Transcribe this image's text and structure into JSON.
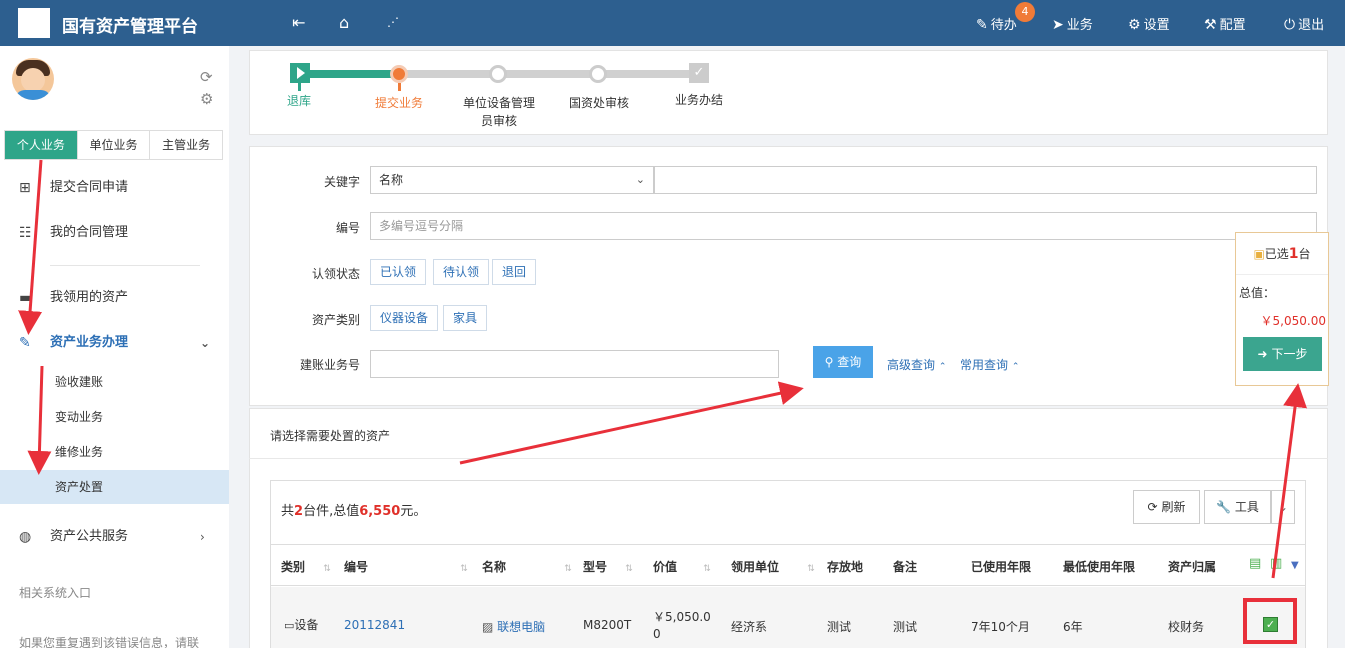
{
  "header": {
    "title": "国有资产管理平台",
    "badge_count": "4",
    "menu": [
      {
        "label": "待办",
        "icon": "edit-icon"
      },
      {
        "label": "业务",
        "icon": "paper-plane-icon"
      },
      {
        "label": "设置",
        "icon": "gear-icon"
      },
      {
        "label": "配置",
        "icon": "wrench-icon"
      },
      {
        "label": "退出",
        "icon": "power-icon"
      }
    ]
  },
  "sidebar": {
    "tabs": [
      "个人业务",
      "单位业务",
      "主管业务"
    ],
    "items": [
      {
        "label": "提交合同申请",
        "icon": "plus-square-icon"
      },
      {
        "label": "我的合同管理",
        "icon": "list-icon"
      },
      {
        "label": "我领用的资产",
        "icon": "laptop-icon"
      },
      {
        "label": "资产业务办理",
        "icon": "pencil-icon"
      },
      {
        "label": "资产公共服务",
        "icon": "globe-icon"
      }
    ],
    "sub_items": [
      "验收建账",
      "变动业务",
      "维修业务",
      "资产处置"
    ],
    "related": "相关系统入口",
    "footer_note": "如果您重复遇到该错误信息，请联"
  },
  "steps": [
    {
      "label": "退库"
    },
    {
      "label": "提交业务"
    },
    {
      "label": "单位设备管理",
      "label2": "员审核"
    },
    {
      "label": "国资处审核"
    },
    {
      "label": "业务办结"
    }
  ],
  "form": {
    "keyword_label": "关键字",
    "keyword_select": "名称",
    "code_label": "编号",
    "code_placeholder": "多编号逗号分隔",
    "status_label": "认领状态",
    "status_options": [
      "已认领",
      "待认领",
      "退回"
    ],
    "category_label": "资产类别",
    "category_options": [
      "仪器设备",
      "家具"
    ],
    "account_label": "建账业务号",
    "query_button": "查询",
    "advanced_query": "高级查询",
    "common_query": "常用查询"
  },
  "selection": {
    "prefix": "已选",
    "count": "1",
    "unit": "台",
    "total_label": "总值：",
    "total_value": "￥5,050.00",
    "next_button": "下一步"
  },
  "table_section": {
    "heading": "请选择需要处置的资产",
    "summary_prefix": "共",
    "summary_count": "2",
    "summary_mid": "台件,总值",
    "summary_total": "6,550",
    "summary_suffix": "元。",
    "refresh_button": "刷新",
    "tools_button": "工具",
    "columns": [
      "类别",
      "编号",
      "名称",
      "型号",
      "价值",
      "领用单位",
      "存放地",
      "备注",
      "已使用年限",
      "最低使用年限",
      "资产归属"
    ],
    "rows": [
      {
        "category": "设备",
        "code": "20112841",
        "name": "联想电脑",
        "model": "M8200T",
        "value_line1": "￥5,050.0",
        "value_line2": "0",
        "unit": "经济系",
        "location": "测试",
        "remark": "测试",
        "used_years": "7年10个月",
        "min_years": "6年",
        "owner": "校财务"
      }
    ]
  },
  "colors": {
    "header_bg": "#2d5f8f",
    "accent_green": "#2ea589",
    "link_blue": "#2d6fb5",
    "price_red": "#e0302a",
    "annotation_red": "#e8303a"
  }
}
